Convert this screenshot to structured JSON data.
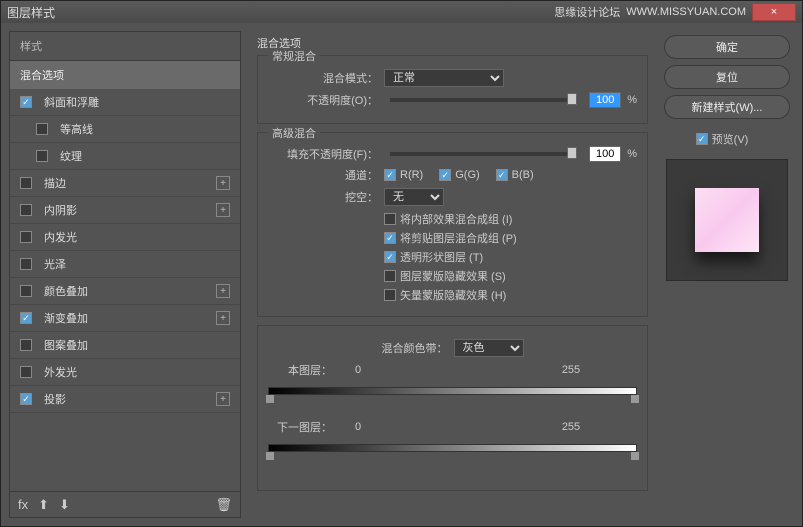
{
  "titlebar": {
    "title": "图层样式",
    "site": "思缘设计论坛",
    "url": "WWW.MISSYUAN.COM",
    "close": "×"
  },
  "left": {
    "header": "样式",
    "selected": "混合选项",
    "items": [
      {
        "label": "斜面和浮雕",
        "checked": true,
        "plus": false
      },
      {
        "label": "等高线",
        "checked": false,
        "plus": false,
        "indent": true
      },
      {
        "label": "纹理",
        "checked": false,
        "plus": false,
        "indent": true
      },
      {
        "label": "描边",
        "checked": false,
        "plus": true
      },
      {
        "label": "内阴影",
        "checked": false,
        "plus": true
      },
      {
        "label": "内发光",
        "checked": false,
        "plus": false
      },
      {
        "label": "光泽",
        "checked": false,
        "plus": false
      },
      {
        "label": "颜色叠加",
        "checked": false,
        "plus": true
      },
      {
        "label": "渐变叠加",
        "checked": true,
        "plus": true
      },
      {
        "label": "图案叠加",
        "checked": false,
        "plus": false
      },
      {
        "label": "外发光",
        "checked": false,
        "plus": false
      },
      {
        "label": "投影",
        "checked": true,
        "plus": true
      }
    ],
    "foot": {
      "fx": "fx",
      "trash": "🗑"
    }
  },
  "center": {
    "title": "混合选项",
    "general": {
      "legend": "常规混合",
      "mode_label": "混合模式：",
      "mode": "正常",
      "opacity_label": "不透明度(O)：",
      "opacity": "100",
      "pct": "%"
    },
    "advanced": {
      "legend": "高级混合",
      "fill_label": "填充不透明度(F)：",
      "fill": "100",
      "pct": "%",
      "channel_label": "通道：",
      "r": "R(R)",
      "g": "G(G)",
      "b": "B(B)",
      "knockout_label": "挖空：",
      "knockout": "无",
      "opts": [
        {
          "label": "将内部效果混合成组 (I)",
          "on": false
        },
        {
          "label": "将剪贴图层混合成组 (P)",
          "on": true
        },
        {
          "label": "透明形状图层 (T)",
          "on": true
        },
        {
          "label": "图层蒙版隐藏效果 (S)",
          "on": false
        },
        {
          "label": "矢量蒙版隐藏效果 (H)",
          "on": false
        }
      ]
    },
    "blendif": {
      "label": "混合颜色带：",
      "value": "灰色",
      "this_label": "本图层：",
      "this_lo": "0",
      "this_hi": "255",
      "under_label": "下一图层：",
      "under_lo": "0",
      "under_hi": "255"
    }
  },
  "right": {
    "ok": "确定",
    "reset": "复位",
    "new": "新建样式(W)...",
    "preview": "预览(V)"
  }
}
